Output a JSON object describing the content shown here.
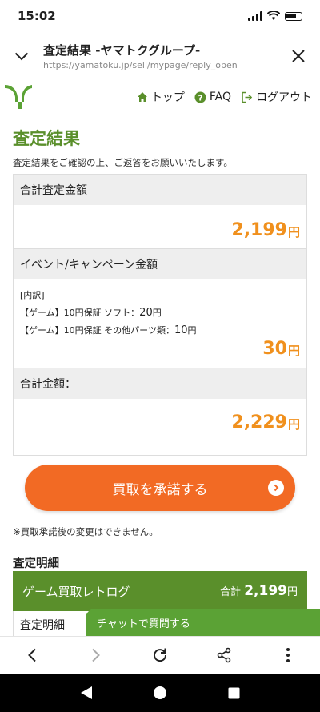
{
  "status": {
    "time": "15:02"
  },
  "browser": {
    "title": "査定結果 -ヤマトクグループ-",
    "url": "https://yamatoku.jp/sell/mypage/reply_open"
  },
  "nav": {
    "top": "トップ",
    "faq": "FAQ",
    "logout": "ログアウト"
  },
  "page": {
    "title": "査定結果",
    "intro": "査定結果をご確認の上、ご返答をお願いいたします。"
  },
  "summary": {
    "assessment_label": "合計査定金額",
    "assessment_amount": "2,199",
    "yen": "円",
    "event_label": "イベント/キャンペーン金額",
    "breakdown_head": "[内訳]",
    "breakdown": [
      {
        "text": "【ゲーム】10円保証 ソフト：",
        "amount": "20",
        "unit": "円"
      },
      {
        "text": "【ゲーム】10円保証 その他パーツ類：",
        "amount": "10",
        "unit": "円"
      }
    ],
    "event_amount": "30",
    "total_label": "合計金額：",
    "total_amount": "2,229"
  },
  "cta": {
    "label": "買取を承諾する"
  },
  "note": "※買取承諾後の変更はできません。",
  "details": {
    "section_title": "査定明細",
    "bar_label": "ゲーム買取レトログ",
    "bar_total_prefix": "合計",
    "bar_total_amount": "2,199",
    "bar_total_unit": "円",
    "row_label": "査定明細"
  },
  "chat": {
    "label": "チャットで質問する"
  },
  "colors": {
    "brand_green": "#5a8f2b",
    "amount_orange": "#f0901d",
    "cta_orange": "#f26a24"
  }
}
